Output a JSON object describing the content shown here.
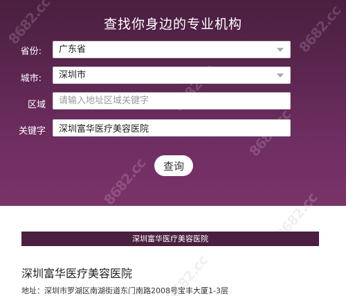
{
  "search": {
    "title": "查找你身边的专业机构",
    "province_label": "省份:",
    "province_value": "广东省",
    "city_label": "城市:",
    "city_value": "深圳市",
    "area_label": "区域",
    "area_placeholder": "请输入地址区域关键字",
    "keyword_label": "关键字",
    "keyword_value": "深圳富华医疗美容医院",
    "query_button": "查询"
  },
  "watermark_text": "8682.cc",
  "result": {
    "header": "深圳富华医疗美容医院",
    "name": "深圳富华医疗美容医院",
    "address": "地址：深圳市罗湖区南湖街道东门南路2008号宝丰大厦1-3层"
  },
  "colors": {
    "panel_top": "#4a1f3f",
    "panel_bottom": "#7a3369",
    "result_bar": "#4a1f3f"
  }
}
